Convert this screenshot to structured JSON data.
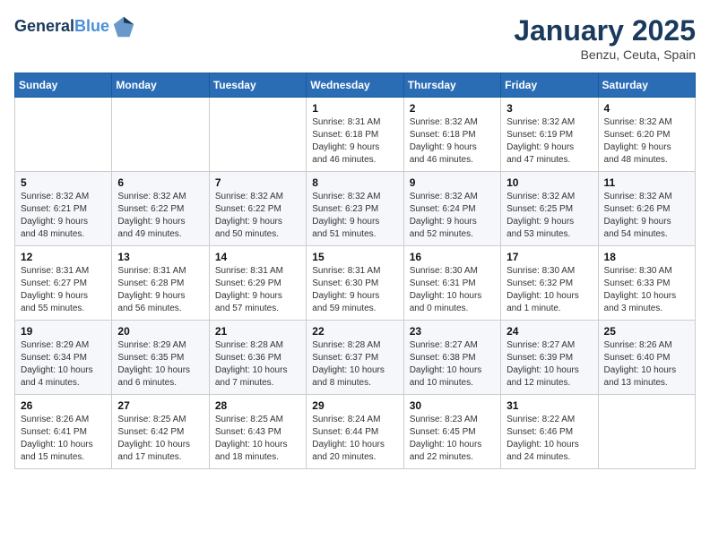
{
  "header": {
    "logo_line1": "General",
    "logo_line2": "Blue",
    "month": "January 2025",
    "location": "Benzu, Ceuta, Spain"
  },
  "weekdays": [
    "Sunday",
    "Monday",
    "Tuesday",
    "Wednesday",
    "Thursday",
    "Friday",
    "Saturday"
  ],
  "weeks": [
    [
      {
        "day": "",
        "info": ""
      },
      {
        "day": "",
        "info": ""
      },
      {
        "day": "",
        "info": ""
      },
      {
        "day": "1",
        "info": "Sunrise: 8:31 AM\nSunset: 6:18 PM\nDaylight: 9 hours\nand 46 minutes."
      },
      {
        "day": "2",
        "info": "Sunrise: 8:32 AM\nSunset: 6:18 PM\nDaylight: 9 hours\nand 46 minutes."
      },
      {
        "day": "3",
        "info": "Sunrise: 8:32 AM\nSunset: 6:19 PM\nDaylight: 9 hours\nand 47 minutes."
      },
      {
        "day": "4",
        "info": "Sunrise: 8:32 AM\nSunset: 6:20 PM\nDaylight: 9 hours\nand 48 minutes."
      }
    ],
    [
      {
        "day": "5",
        "info": "Sunrise: 8:32 AM\nSunset: 6:21 PM\nDaylight: 9 hours\nand 48 minutes."
      },
      {
        "day": "6",
        "info": "Sunrise: 8:32 AM\nSunset: 6:22 PM\nDaylight: 9 hours\nand 49 minutes."
      },
      {
        "day": "7",
        "info": "Sunrise: 8:32 AM\nSunset: 6:22 PM\nDaylight: 9 hours\nand 50 minutes."
      },
      {
        "day": "8",
        "info": "Sunrise: 8:32 AM\nSunset: 6:23 PM\nDaylight: 9 hours\nand 51 minutes."
      },
      {
        "day": "9",
        "info": "Sunrise: 8:32 AM\nSunset: 6:24 PM\nDaylight: 9 hours\nand 52 minutes."
      },
      {
        "day": "10",
        "info": "Sunrise: 8:32 AM\nSunset: 6:25 PM\nDaylight: 9 hours\nand 53 minutes."
      },
      {
        "day": "11",
        "info": "Sunrise: 8:32 AM\nSunset: 6:26 PM\nDaylight: 9 hours\nand 54 minutes."
      }
    ],
    [
      {
        "day": "12",
        "info": "Sunrise: 8:31 AM\nSunset: 6:27 PM\nDaylight: 9 hours\nand 55 minutes."
      },
      {
        "day": "13",
        "info": "Sunrise: 8:31 AM\nSunset: 6:28 PM\nDaylight: 9 hours\nand 56 minutes."
      },
      {
        "day": "14",
        "info": "Sunrise: 8:31 AM\nSunset: 6:29 PM\nDaylight: 9 hours\nand 57 minutes."
      },
      {
        "day": "15",
        "info": "Sunrise: 8:31 AM\nSunset: 6:30 PM\nDaylight: 9 hours\nand 59 minutes."
      },
      {
        "day": "16",
        "info": "Sunrise: 8:30 AM\nSunset: 6:31 PM\nDaylight: 10 hours\nand 0 minutes."
      },
      {
        "day": "17",
        "info": "Sunrise: 8:30 AM\nSunset: 6:32 PM\nDaylight: 10 hours\nand 1 minute."
      },
      {
        "day": "18",
        "info": "Sunrise: 8:30 AM\nSunset: 6:33 PM\nDaylight: 10 hours\nand 3 minutes."
      }
    ],
    [
      {
        "day": "19",
        "info": "Sunrise: 8:29 AM\nSunset: 6:34 PM\nDaylight: 10 hours\nand 4 minutes."
      },
      {
        "day": "20",
        "info": "Sunrise: 8:29 AM\nSunset: 6:35 PM\nDaylight: 10 hours\nand 6 minutes."
      },
      {
        "day": "21",
        "info": "Sunrise: 8:28 AM\nSunset: 6:36 PM\nDaylight: 10 hours\nand 7 minutes."
      },
      {
        "day": "22",
        "info": "Sunrise: 8:28 AM\nSunset: 6:37 PM\nDaylight: 10 hours\nand 8 minutes."
      },
      {
        "day": "23",
        "info": "Sunrise: 8:27 AM\nSunset: 6:38 PM\nDaylight: 10 hours\nand 10 minutes."
      },
      {
        "day": "24",
        "info": "Sunrise: 8:27 AM\nSunset: 6:39 PM\nDaylight: 10 hours\nand 12 minutes."
      },
      {
        "day": "25",
        "info": "Sunrise: 8:26 AM\nSunset: 6:40 PM\nDaylight: 10 hours\nand 13 minutes."
      }
    ],
    [
      {
        "day": "26",
        "info": "Sunrise: 8:26 AM\nSunset: 6:41 PM\nDaylight: 10 hours\nand 15 minutes."
      },
      {
        "day": "27",
        "info": "Sunrise: 8:25 AM\nSunset: 6:42 PM\nDaylight: 10 hours\nand 17 minutes."
      },
      {
        "day": "28",
        "info": "Sunrise: 8:25 AM\nSunset: 6:43 PM\nDaylight: 10 hours\nand 18 minutes."
      },
      {
        "day": "29",
        "info": "Sunrise: 8:24 AM\nSunset: 6:44 PM\nDaylight: 10 hours\nand 20 minutes."
      },
      {
        "day": "30",
        "info": "Sunrise: 8:23 AM\nSunset: 6:45 PM\nDaylight: 10 hours\nand 22 minutes."
      },
      {
        "day": "31",
        "info": "Sunrise: 8:22 AM\nSunset: 6:46 PM\nDaylight: 10 hours\nand 24 minutes."
      },
      {
        "day": "",
        "info": ""
      }
    ]
  ]
}
